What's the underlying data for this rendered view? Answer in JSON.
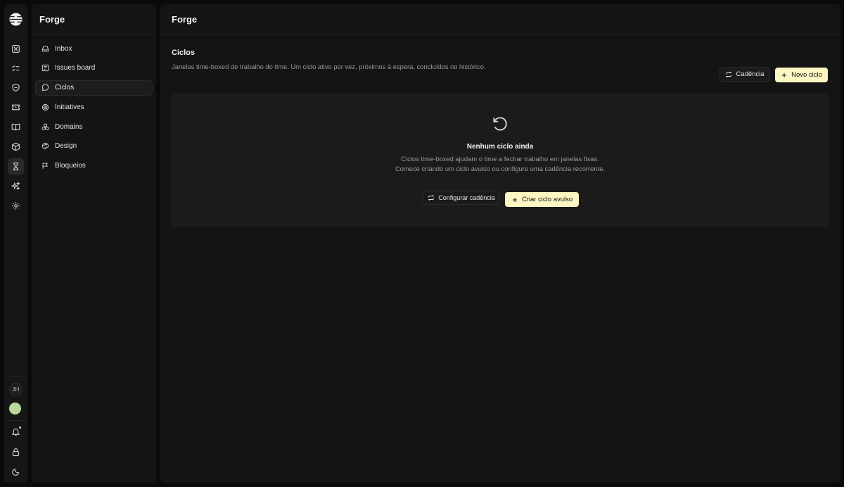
{
  "app": {
    "workspace_title": "Forge",
    "user_initials": "JH"
  },
  "rail": {
    "items": [
      {
        "icon": "inbox-x-icon"
      },
      {
        "icon": "list-checks-icon"
      },
      {
        "icon": "shield-icon"
      },
      {
        "icon": "ticket-icon"
      },
      {
        "icon": "book-open-icon"
      },
      {
        "icon": "box-icon"
      },
      {
        "icon": "hourglass-icon",
        "active": true
      },
      {
        "icon": "sparkles-icon"
      },
      {
        "icon": "gear-icon"
      }
    ],
    "bottom": [
      {
        "icon": "bell-icon"
      },
      {
        "icon": "lock-icon"
      },
      {
        "icon": "moon-icon"
      }
    ]
  },
  "sidebar": {
    "items": [
      {
        "label": "Inbox",
        "icon": "inbox-icon"
      },
      {
        "label": "Issues board",
        "icon": "board-icon"
      },
      {
        "label": "Ciclos",
        "icon": "message-circle-icon",
        "active": true
      },
      {
        "label": "Initiatives",
        "icon": "target-icon"
      },
      {
        "label": "Domains",
        "icon": "boxes-icon"
      },
      {
        "label": "Design",
        "icon": "palette-icon"
      },
      {
        "label": "Bloqueios",
        "icon": "flag-icon"
      }
    ]
  },
  "main": {
    "title": "Forge",
    "section_title": "Ciclos",
    "section_desc": "Janelas time-boxed de trabalho do time. Um ciclo ativo por vez, próximos à espera, concluídos no histórico.",
    "cadence_button": "Cadência",
    "new_cycle_button": "Novo ciclo",
    "empty": {
      "title": "Nenhum ciclo ainda",
      "desc": "Ciclos time-boxed ajudam o time a fechar trabalho em janelas fixas. Comece criando um ciclo avulso ou configure uma cadência recorrente.",
      "configure_button": "Configurar cadência",
      "create_button": "Criar ciclo avulso"
    }
  },
  "colors": {
    "accent": "#fbf6c2",
    "avatar": "#b9d89a"
  }
}
